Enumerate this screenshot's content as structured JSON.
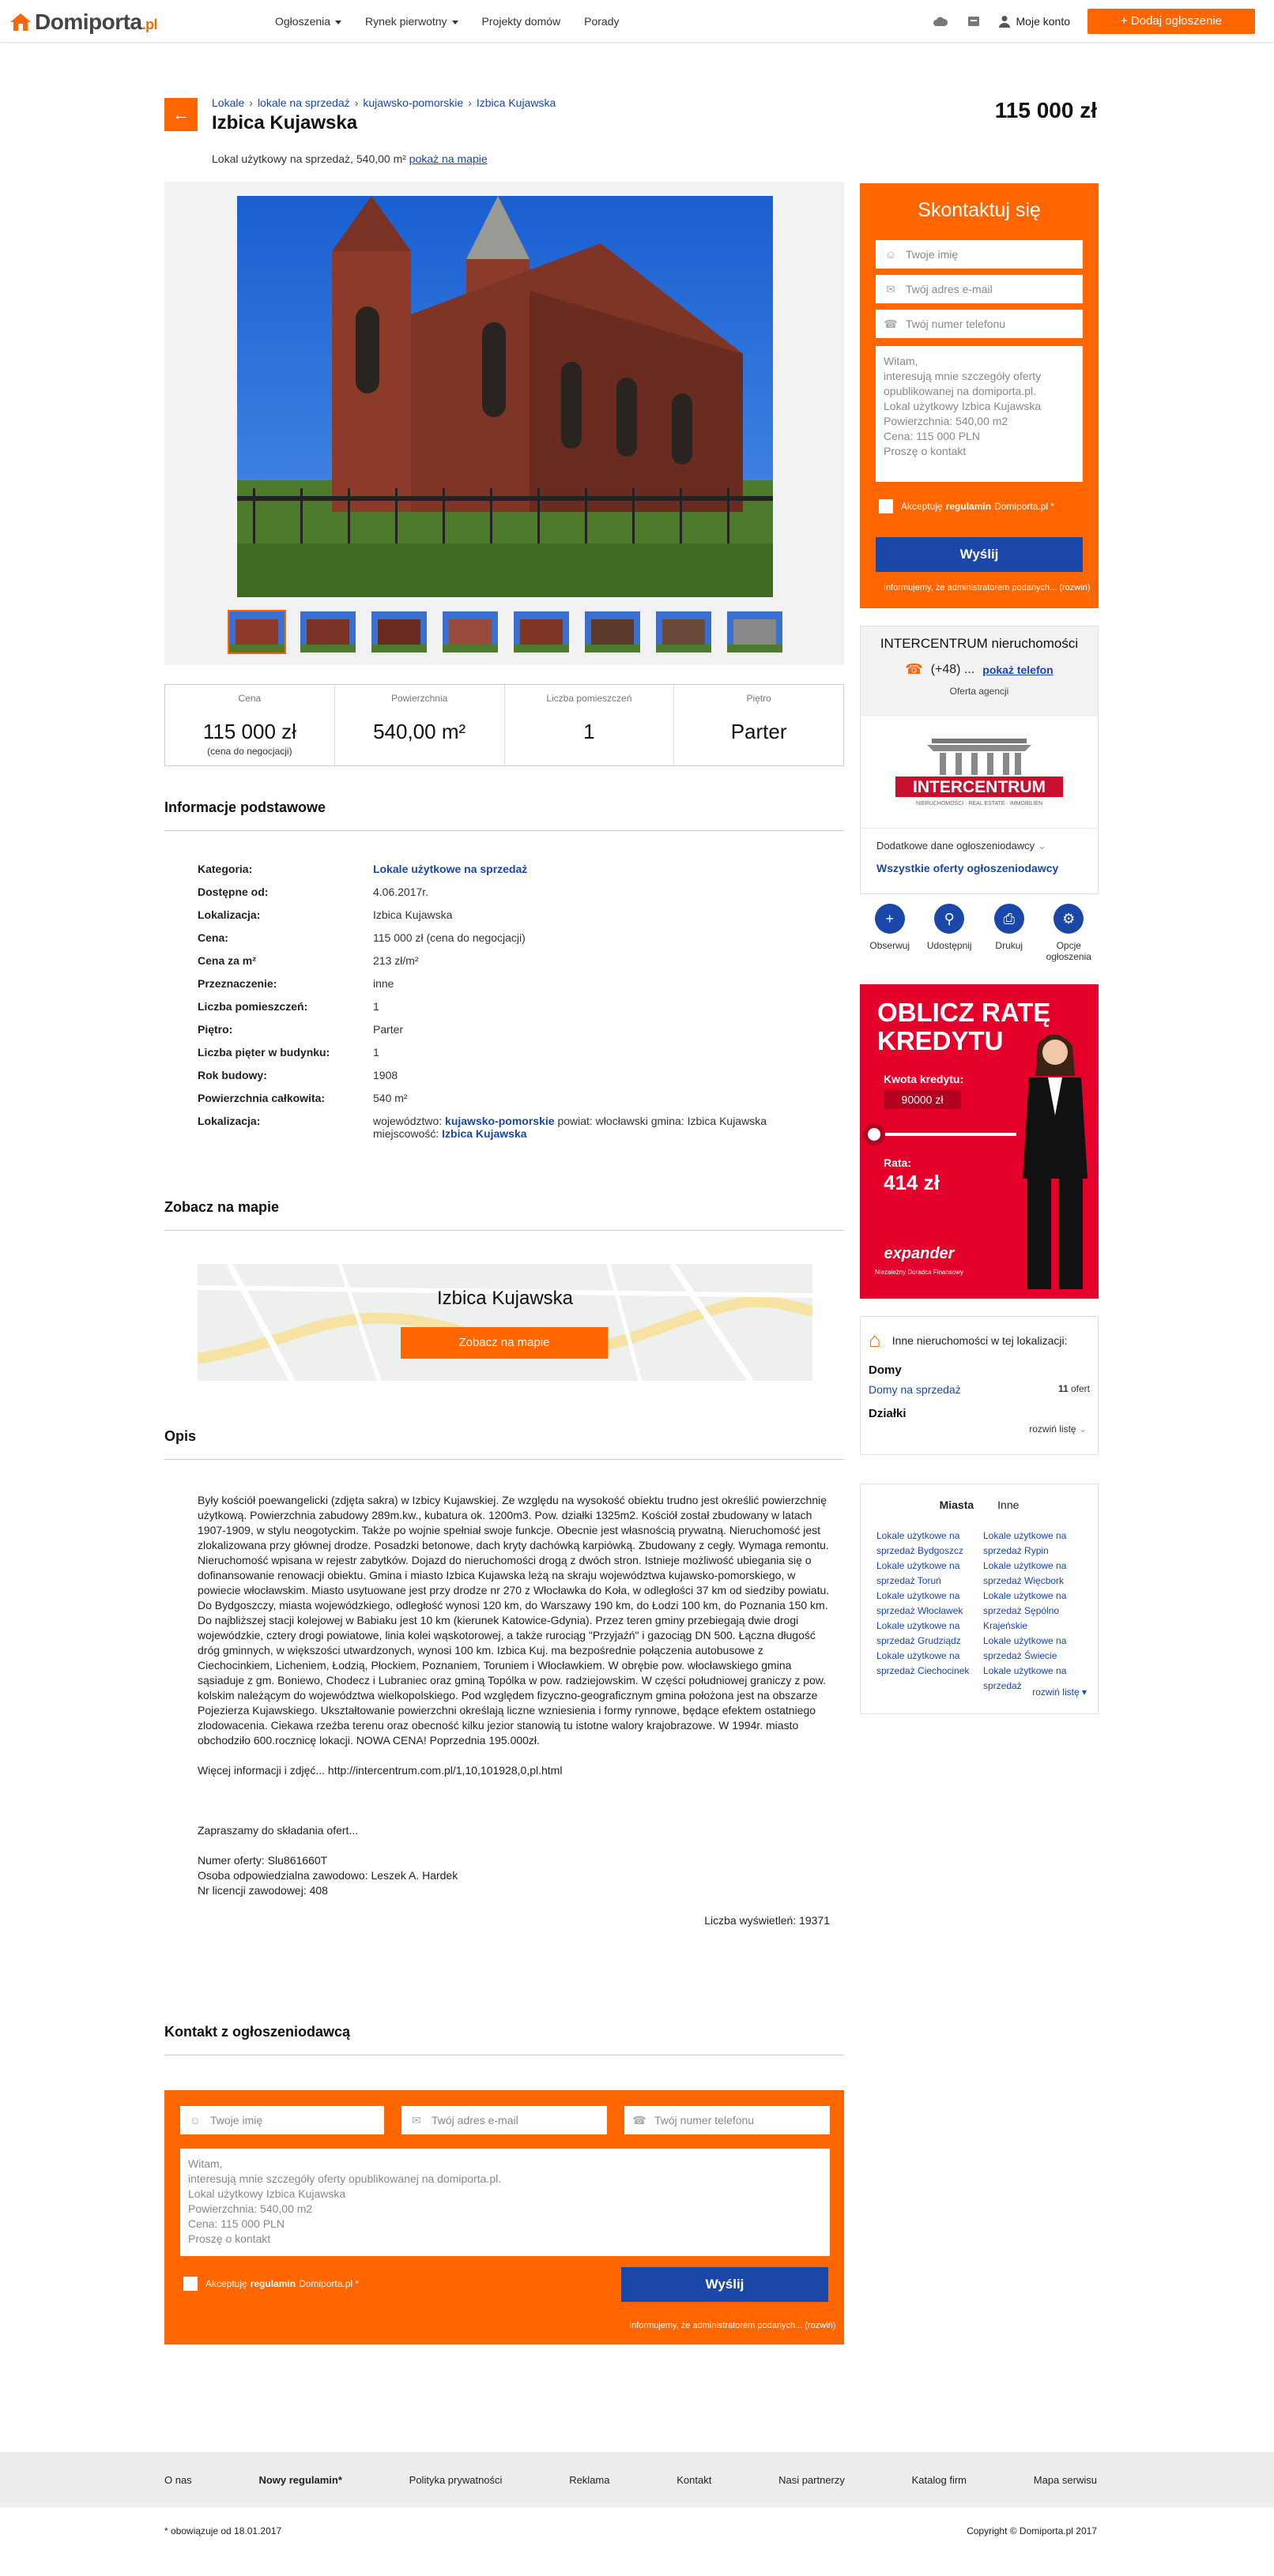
{
  "header": {
    "logo_text": "Domiporta",
    "logo_tld": ".pl",
    "nav": [
      {
        "label": "Ogłoszenia",
        "dropdown": true
      },
      {
        "label": "Rynek pierwotny",
        "dropdown": true
      },
      {
        "label": "Projekty domów",
        "dropdown": false
      },
      {
        "label": "Porady",
        "dropdown": false
      }
    ],
    "my_account": "Moje konto",
    "add_button": "+ Dodaj ogłoszenie"
  },
  "listing": {
    "breadcrumb": [
      "Lokale",
      "lokale na sprzedaż",
      "kujawsko-pomorskie",
      "Izbica Kujawska"
    ],
    "title": "Izbica Kujawska",
    "price": "115 000 zł",
    "subtitle": "Lokal użytkowy na sprzedaż, 540,00 m²",
    "map_link": "pokaż na mapie"
  },
  "gallery": {
    "thumb_count": 8,
    "active_index": 0
  },
  "facts": [
    {
      "label": "Cena",
      "value": "115 000 zł",
      "note": "(cena do negocjacji)"
    },
    {
      "label": "Powierzchnia",
      "value": "540,00 m²",
      "note": ""
    },
    {
      "label": "Liczba pomieszczeń",
      "value": "1",
      "note": ""
    },
    {
      "label": "Piętro",
      "value": "Parter",
      "note": ""
    }
  ],
  "sections": {
    "info": "Informacje podstawowe",
    "map": "Zobacz na mapie",
    "desc": "Opis",
    "contact": "Kontakt z ogłoszeniodawcą"
  },
  "info_rows": [
    {
      "k": "Kategoria:",
      "v": "Lokale użytkowe na sprzedaż",
      "link": true
    },
    {
      "k": "Dostępne od:",
      "v": "4.06.2017r.",
      "link": false
    },
    {
      "k": "Lokalizacja:",
      "v": "Izbica Kujawska",
      "link": false
    },
    {
      "k": "Cena:",
      "v": "115 000 zł (cena do negocjacji)",
      "link": false
    },
    {
      "k": "Cena za m²",
      "v": "213 zł/m²",
      "link": false
    },
    {
      "k": "Przeznaczenie:",
      "v": "inne",
      "link": false
    },
    {
      "k": "Liczba pomieszczeń:",
      "v": "1",
      "link": false
    },
    {
      "k": "Piętro:",
      "v": "Parter",
      "link": false
    },
    {
      "k": "Liczba pięter w budynku:",
      "v": "1",
      "link": false
    },
    {
      "k": "Rok budowy:",
      "v": "1908",
      "link": false
    },
    {
      "k": "Powierzchnia całkowita:",
      "v": "540 m²",
      "link": false
    }
  ],
  "location_row": {
    "k": "Lokalizacja:",
    "woj_label": "województwo:",
    "woj": "kujawsko-pomorskie",
    "rest": "powiat: włocławski gmina: Izbica Kujawska",
    "miej_label": "miejscowość:",
    "miej": "Izbica Kujawska"
  },
  "map": {
    "title": "Izbica Kujawska",
    "button": "Zobacz na mapie"
  },
  "description": {
    "paragraphs": [
      "Były kościół poewangelicki (zdjęta sakra) w Izbicy Kujawskiej. Ze względu na wysokość obiektu trudno jest określić powierzchnię użytkową. Powierzchnia zabudowy 289m.kw., kubatura ok. 1200m3. Pow. działki 1325m2. Kościół został zbudowany w latach 1907-1909, w stylu neogotyckim. Także po wojnie spełniał swoje funkcje. Obecnie jest własnością prywatną. Nieruchomość jest zlokalizowana przy głównej drodze. Posadzki betonowe, dach kryty dachówką karpiówką. Zbudowany z cegły. Wymaga remontu. Nieruchomość wpisana w rejestr zabytków. Dojazd do nieruchomości drogą z dwóch stron. Istnieje możliwość ubiegania się o dofinansowanie renowacji obiektu. Gmina i miasto Izbica Kujawska leżą na skraju województwa kujawsko-pomorskiego, w powiecie włocławskim. Miasto usytuowane jest przy drodze nr 270 z Włocławka do Koła, w odległości 37 km od siedziby powiatu. Do Bydgoszczy, miasta wojewódzkiego, odległość wynosi 120 km, do Warszawy 190 km, do Łodzi 100 km, do Poznania 150 km. Do najbliższej stacji kolejowej w Babiaku jest 10 km (kierunek Katowice-Gdynia). Przez teren gminy przebiegają dwie drogi wojewódzkie, cztery drogi powiatowe, linia kolei wąskotorowej, a także rurociąg \"Przyjaźń\" i gazociąg DN 500. Łączna długość dróg gminnych, w większości utwardzonych, wynosi 100 km. Izbica Kuj. ma bezpośrednie połączenia autobusowe z Ciechocinkiem, Licheniem, Łodzią, Płockiem, Poznaniem, Toruniem i Włocławkiem. W obrębie pow. włocławskiego gmina sąsiaduje z gm. Boniewo, Chodecz i Lubraniec oraz gminą Topólka w pow. radziejowskim. W części południowej graniczy z pow. kolskim należącym do województwa wielkopolskiego. Pod względem fizyczno-geograficznym gmina położona jest na obszarze Pojezierza Kujawskiego. Ukształtowanie powierzchni określają liczne wzniesienia i formy rynnowe, będące efektem ostatniego zlodowacenia. Ciekawa rzeźba terenu oraz obecność kilku jezior stanowią tu istotne walory krajobrazowe. W 1994r. miasto obchodziło 600.rocznicę lokacji. NOWA CENA! Poprzednia 195.000zł.",
      "Więcej informacji i zdjęć... http://intercentrum.com.pl/1,10,101928,0,pl.html",
      "",
      "Zapraszamy do składania ofert...",
      "Numer oferty: Slu861660T\nOsoba odpowiedzialna zawodowo: Leszek A. Hardek\nNr licencji zawodowej: 408"
    ],
    "views": "Liczba wyświetleń: 19371"
  },
  "form": {
    "heading": "Skontaktuj się",
    "name_placeholder": "Twoje imię",
    "email_placeholder": "Twój adres e-mail",
    "phone_placeholder": "Twój numer telefonu",
    "message": "Witam,\ninteresują mnie szczegóły oferty opublikowanej na domiporta.pl.\nLokal użytkowy Izbica Kujawska\nPowierzchnia: 540,00 m2\nCena: 115 000 PLN\nProszę o kontakt",
    "accept_prefix": "Akceptuję",
    "accept_link": "regulamin",
    "accept_suffix": "Domiporta.pl *",
    "send": "Wyślij",
    "admin_note": "Informujemy, że administratorem podanych... (rozwiń)"
  },
  "agency": {
    "name": "INTERCENTRUM nieruchomości",
    "phone": "(+48) ...",
    "show_phone": "pokaż telefon",
    "offer_label": "Oferta agencji",
    "logo_text": "INTERCENTRUM",
    "logo_sub": "NIERUCHOMOŚCI · REAL ESTATE · IMMOBILIEN",
    "more_data": "Dodatkowe dane ogłoszeniodawcy",
    "all_offers": "Wszystkie oferty ogłoszeniodawcy"
  },
  "actions": [
    {
      "label": "Obserwuj",
      "icon": "plus-icon",
      "glyph": "+"
    },
    {
      "label": "Udostępnij",
      "icon": "share-icon",
      "glyph": "⚲"
    },
    {
      "label": "Drukuj",
      "icon": "print-icon",
      "glyph": "⎙"
    },
    {
      "label": "Opcje ogłoszenia",
      "icon": "settings-icon",
      "glyph": "⚙"
    }
  ],
  "banner": {
    "title_line1": "OBLICZ RATĘ",
    "title_line2": "KREDYTU",
    "amount_label": "Kwota kredytu:",
    "amount": "90000 zł",
    "rate_label": "Rata:",
    "rate": "414 zł",
    "brand": "expander",
    "brand_sub": "Niezależny Doradca Finansowy"
  },
  "nearby": {
    "title": "Inne nieruchomości w tej lokalizacji:",
    "categories": [
      {
        "name": "Domy",
        "link": "Domy na sprzedaż",
        "count": "11",
        "unit": "ofert"
      },
      {
        "name": "Działki",
        "link": "",
        "count": "",
        "unit": ""
      }
    ],
    "expand": "rozwiń listę"
  },
  "locations": {
    "tabs": [
      "Miasta",
      "Inne"
    ],
    "col1": [
      "Lokale użytkowe na sprzedaż Bydgoszcz",
      "Lokale użytkowe na sprzedaż Toruń",
      "Lokale użytkowe na sprzedaż Włocławek",
      "Lokale użytkowe na sprzedaż Grudziądz",
      "Lokale użytkowe na sprzedaż Ciechocinek"
    ],
    "col2": [
      "Lokale użytkowe na sprzedaż Rypin",
      "Lokale użytkowe na sprzedaż Więcbork",
      "Lokale użytkowe na sprzedaż Sępólno Krajeńskie",
      "Lokale użytkowe na sprzedaż Świecie",
      "Lokale użytkowe na sprzedaż"
    ],
    "expand": "rozwiń listę"
  },
  "footer": {
    "links": [
      {
        "label": "O nas",
        "bold": false
      },
      {
        "label": "Nowy regulamin*",
        "bold": true
      },
      {
        "label": "Polityka prywatności",
        "bold": false
      },
      {
        "label": "Reklama",
        "bold": false
      },
      {
        "label": "Kontakt",
        "bold": false
      },
      {
        "label": "Nasi partnerzy",
        "bold": false
      },
      {
        "label": "Katalog firm",
        "bold": false
      },
      {
        "label": "Mapa serwisu",
        "bold": false
      }
    ],
    "note": "* obowiązuje od 18.01.2017",
    "copyright": "Copyright © Domiporta.pl 2017"
  },
  "colors": {
    "accent": "#ff6600",
    "link": "#1a47a8",
    "banner": "#e4002b"
  }
}
